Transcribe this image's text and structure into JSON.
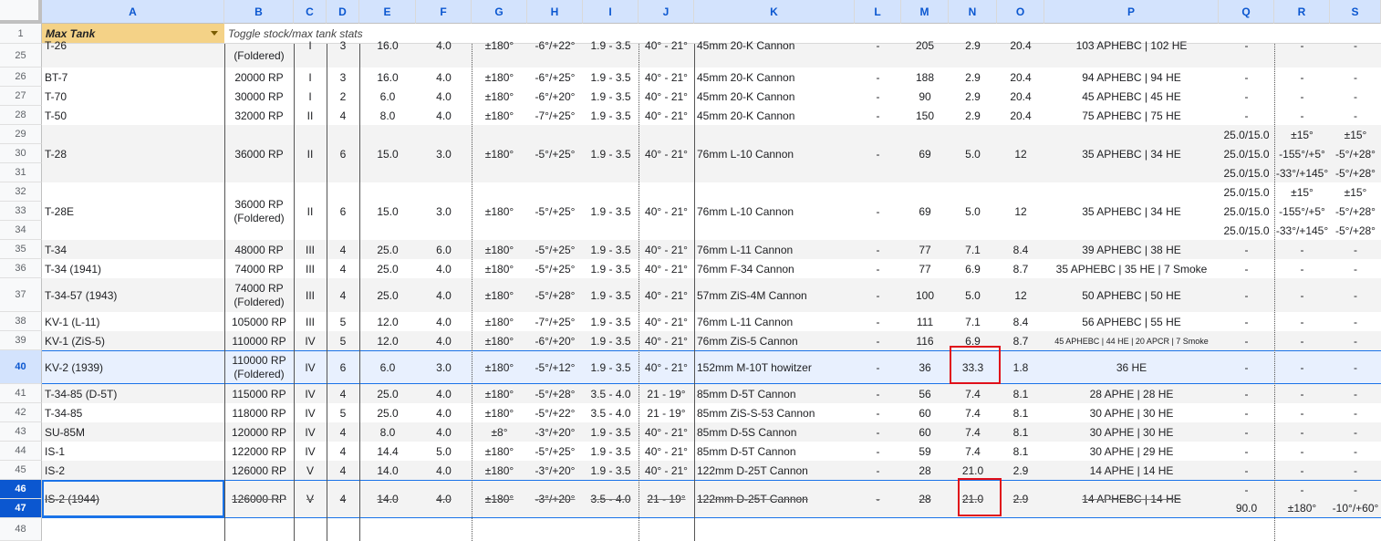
{
  "columns": [
    "A",
    "B",
    "C",
    "D",
    "E",
    "F",
    "G",
    "H",
    "I",
    "J",
    "K",
    "L",
    "M",
    "N",
    "O",
    "P",
    "Q",
    "R",
    "S"
  ],
  "row1": {
    "num": "1",
    "a": "Max Tank",
    "b": "Toggle stock/max tank stats"
  },
  "rows": [
    {
      "num": "25",
      "cells": [
        "T-26",
        "(Foldered)",
        "I",
        "3",
        "16.0",
        "4.0",
        "±180°",
        "-6°/+22°",
        "1.9 - 3.5",
        "40° - 21°",
        "45mm 20-K Cannon",
        "-",
        "205",
        "2.9",
        "20.4",
        "103 APHEBC | 102 HE",
        "-",
        "-",
        "-"
      ]
    },
    {
      "num": "26",
      "cells": [
        "BT-7",
        "20000 RP",
        "I",
        "3",
        "16.0",
        "4.0",
        "±180°",
        "-6°/+25°",
        "1.9 - 3.5",
        "40° - 21°",
        "45mm 20-K Cannon",
        "-",
        "188",
        "2.9",
        "20.4",
        "94 APHEBC | 94 HE",
        "-",
        "-",
        "-"
      ]
    },
    {
      "num": "27",
      "cells": [
        "T-70",
        "30000 RP",
        "I",
        "2",
        "6.0",
        "4.0",
        "±180°",
        "-6°/+20°",
        "1.9 - 3.5",
        "40° - 21°",
        "45mm 20-K Cannon",
        "-",
        "90",
        "2.9",
        "20.4",
        "45 APHEBC | 45 HE",
        "-",
        "-",
        "-"
      ]
    },
    {
      "num": "28",
      "cells": [
        "T-50",
        "32000 RP",
        "II",
        "4",
        "8.0",
        "4.0",
        "±180°",
        "-7°/+25°",
        "1.9 - 3.5",
        "40° - 21°",
        "45mm 20-K Cannon",
        "-",
        "150",
        "2.9",
        "20.4",
        "75 APHEBC | 75 HE",
        "-",
        "-",
        "-"
      ]
    },
    {
      "num": "29",
      "cells": [
        "",
        "",
        "",
        "",
        "",
        "",
        "",
        "",
        "",
        "",
        "",
        "",
        "",
        "",
        "",
        "",
        "25.0/15.0",
        "±15°",
        "±15°"
      ]
    },
    {
      "num": "30",
      "cells": [
        "T-28",
        "36000 RP",
        "II",
        "6",
        "15.0",
        "3.0",
        "±180°",
        "-5°/+25°",
        "1.9 - 3.5",
        "40° - 21°",
        "76mm L-10 Cannon",
        "-",
        "69",
        "5.0",
        "12",
        "35 APHEBC | 34 HE",
        "25.0/15.0",
        "-155°/+5°",
        "-5°/+28°"
      ]
    },
    {
      "num": "31",
      "cells": [
        "",
        "",
        "",
        "",
        "",
        "",
        "",
        "",
        "",
        "",
        "",
        "",
        "",
        "",
        "",
        "",
        "25.0/15.0",
        "-33°/+145°",
        "-5°/+28°"
      ]
    },
    {
      "num": "32",
      "cells": [
        "",
        "",
        "",
        "",
        "",
        "",
        "",
        "",
        "",
        "",
        "",
        "",
        "",
        "",
        "",
        "",
        "25.0/15.0",
        "±15°",
        "±15°"
      ]
    },
    {
      "num": "33",
      "cells": [
        "T-28E",
        "36000 RP",
        "II",
        "6",
        "15.0",
        "3.0",
        "±180°",
        "-5°/+25°",
        "1.9 - 3.5",
        "40° - 21°",
        "76mm L-10 Cannon",
        "-",
        "69",
        "5.0",
        "12",
        "35 APHEBC | 34 HE",
        "25.0/15.0",
        "-155°/+5°",
        "-5°/+28°"
      ]
    },
    {
      "num": "34",
      "cells": [
        "",
        "(Foldered)",
        "",
        "",
        "",
        "",
        "",
        "",
        "",
        "",
        "",
        "",
        "",
        "",
        "",
        "",
        "25.0/15.0",
        "-33°/+145°",
        "-5°/+28°"
      ]
    },
    {
      "num": "35",
      "cells": [
        "T-34",
        "48000 RP",
        "III",
        "4",
        "25.0",
        "6.0",
        "±180°",
        "-5°/+25°",
        "1.9 - 3.5",
        "40° - 21°",
        "76mm L-11 Cannon",
        "-",
        "77",
        "7.1",
        "8.4",
        "39 APHEBC | 38 HE",
        "-",
        "-",
        "-"
      ]
    },
    {
      "num": "36",
      "cells": [
        "T-34 (1941)",
        "74000 RP",
        "III",
        "4",
        "25.0",
        "4.0",
        "±180°",
        "-5°/+25°",
        "1.9 - 3.5",
        "40° - 21°",
        "76mm F-34 Cannon",
        "-",
        "77",
        "6.9",
        "8.7",
        "35 APHEBC | 35 HE | 7 Smoke",
        "-",
        "-",
        "-"
      ]
    },
    {
      "num": "37",
      "cells": [
        "T-34-57 (1943)",
        "74000 RP",
        "III",
        "4",
        "25.0",
        "4.0",
        "±180°",
        "-5°/+28°",
        "1.9 - 3.5",
        "40° - 21°",
        "57mm ZiS-4M Cannon",
        "-",
        "100",
        "5.0",
        "12",
        "50 APHEBC | 50 HE",
        "-",
        "-",
        "-"
      ]
    },
    {
      "num": "38",
      "cells": [
        "KV-1 (L-11)",
        "105000 RP",
        "III",
        "5",
        "12.0",
        "4.0",
        "±180°",
        "-7°/+25°",
        "1.9 - 3.5",
        "40° - 21°",
        "76mm L-11 Cannon",
        "-",
        "111",
        "7.1",
        "8.4",
        "56 APHEBC | 55 HE",
        "-",
        "-",
        "-"
      ]
    },
    {
      "num": "39",
      "cells": [
        "KV-1 (ZiS-5)",
        "110000 RP",
        "IV",
        "5",
        "12.0",
        "4.0",
        "±180°",
        "-6°/+20°",
        "1.9 - 3.5",
        "40° - 21°",
        "76mm ZiS-5 Cannon",
        "-",
        "116",
        "6.9",
        "8.7",
        "45 APHEBC | 44 HE | 20 APCR | 7 Smoke",
        "-",
        "-",
        "-"
      ]
    },
    {
      "num": "40",
      "cells": [
        "KV-2 (1939)",
        "110000 RP",
        "IV",
        "6",
        "6.0",
        "3.0",
        "±180°",
        "-5°/+12°",
        "1.9 - 3.5",
        "40° - 21°",
        "152mm M-10T howitzer",
        "-",
        "36",
        "33.3",
        "1.8",
        "36 HE",
        "-",
        "-",
        "-"
      ]
    },
    {
      "num": "41",
      "cells": [
        "T-34-85 (D-5T)",
        "115000 RP",
        "IV",
        "4",
        "25.0",
        "4.0",
        "±180°",
        "-5°/+28°",
        "3.5 - 4.0",
        "21 - 19°",
        "85mm D-5T Cannon",
        "-",
        "56",
        "7.4",
        "8.1",
        "28 APHE | 28 HE",
        "-",
        "-",
        "-"
      ]
    },
    {
      "num": "42",
      "cells": [
        "T-34-85",
        "118000 RP",
        "IV",
        "5",
        "25.0",
        "4.0",
        "±180°",
        "-5°/+22°",
        "3.5 - 4.0",
        "21 - 19°",
        "85mm ZiS-S-53 Cannon",
        "-",
        "60",
        "7.4",
        "8.1",
        "30 APHE | 30 HE",
        "-",
        "-",
        "-"
      ]
    },
    {
      "num": "43",
      "cells": [
        "SU-85M",
        "120000 RP",
        "IV",
        "4",
        "8.0",
        "4.0",
        "±8°",
        "-3°/+20°",
        "1.9 - 3.5",
        "40° - 21°",
        "85mm D-5S Cannon",
        "-",
        "60",
        "7.4",
        "8.1",
        "30 APHE | 30 HE",
        "-",
        "-",
        "-"
      ]
    },
    {
      "num": "44",
      "cells": [
        "IS-1",
        "122000 RP",
        "IV",
        "4",
        "14.4",
        "5.0",
        "±180°",
        "-5°/+25°",
        "1.9 - 3.5",
        "40° - 21°",
        "85mm D-5T Cannon",
        "-",
        "59",
        "7.4",
        "8.1",
        "30 APHE | 29 HE",
        "-",
        "-",
        "-"
      ]
    },
    {
      "num": "45",
      "cells": [
        "IS-2",
        "126000 RP",
        "V",
        "4",
        "14.0",
        "4.0",
        "±180°",
        "-3°/+20°",
        "1.9 - 3.5",
        "40° - 21°",
        "122mm D-25T Cannon",
        "-",
        "28",
        "21.0",
        "2.9",
        "14 APHE | 14 HE",
        "-",
        "-",
        "-"
      ]
    },
    {
      "num": "46",
      "cells": [
        "",
        "",
        "",
        "",
        "",
        "",
        "",
        "",
        "",
        "",
        "",
        "",
        "",
        "",
        "",
        "",
        "-",
        "-",
        "-"
      ]
    },
    {
      "num": "47",
      "cells": [
        "IS-2 (1944)",
        "126000 RP",
        "V",
        "4",
        "14.0",
        "4.0",
        "±180°",
        "-3°/+20°",
        "3.5 - 4.0",
        "21 - 19°",
        "122mm D-25T Cannon",
        "-",
        "28",
        "21.0",
        "2.9",
        "14 APHEBC | 14 HE",
        "90.0",
        "±180°",
        "-10°/+60°"
      ]
    },
    {
      "num": "48",
      "cells": [
        "",
        "",
        "",
        "",
        "",
        "",
        "",
        "",
        "",
        "",
        "",
        "",
        "",
        "",
        "",
        "",
        "",
        "",
        ""
      ]
    }
  ]
}
